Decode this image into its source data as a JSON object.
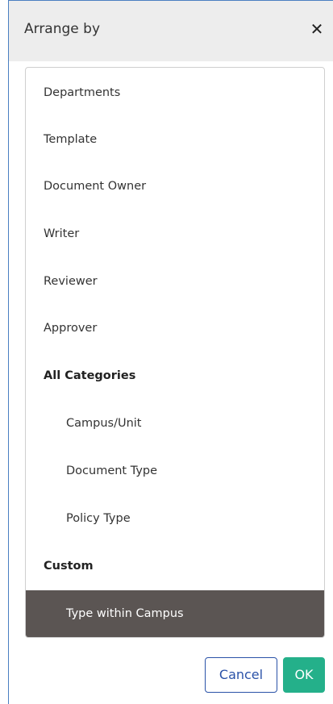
{
  "dialog": {
    "title": "Arrange by",
    "close_glyph": "✕",
    "close_icon": "close-icon"
  },
  "options": {
    "departments": "Departments",
    "template": "Template",
    "document_owner": "Document Owner",
    "writer": "Writer",
    "reviewer": "Reviewer",
    "approver": "Approver",
    "all_categories": "All Categories",
    "campus_unit": "Campus/Unit",
    "document_type": "Document Type",
    "policy_type": "Policy Type",
    "custom": "Custom",
    "type_within_campus": "Type within Campus"
  },
  "selected_option": "Type within Campus",
  "buttons": {
    "cancel": "Cancel",
    "ok": "OK"
  },
  "colors": {
    "selected_bg": "#5b5553",
    "ok_bg": "#24b08a",
    "cancel_border": "#2a52a8",
    "header_bg": "#ededed"
  }
}
